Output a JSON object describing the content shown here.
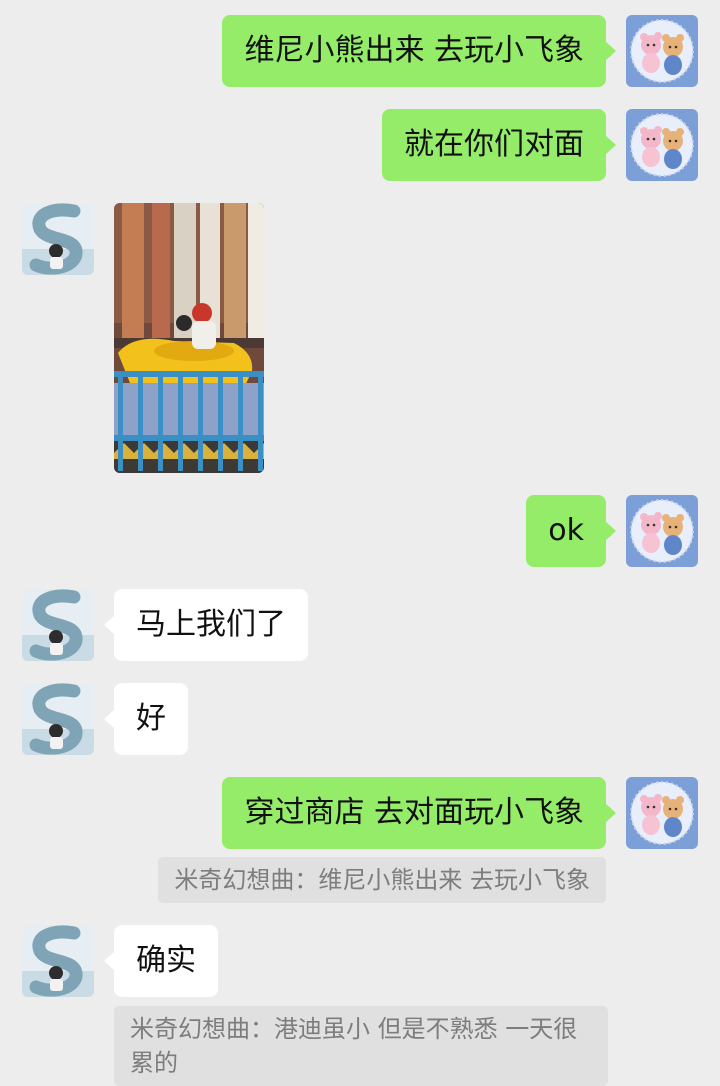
{
  "messages": [
    {
      "text": "维尼小熊出来 去玩小飞象"
    },
    {
      "text": "就在你们对面"
    },
    {
      "image": "photo-amusement-ride"
    },
    {
      "text": "ok"
    },
    {
      "text": "马上我们了"
    },
    {
      "text": "好"
    },
    {
      "text": "穿过商店 去对面玩小飞象",
      "quote": "米奇幻想曲：维尼小熊出来 去玩小飞象"
    },
    {
      "text": "确实",
      "quote": "米奇幻想曲：港迪虽小 但是不熟悉 一天很累的"
    }
  ],
  "colors": {
    "background": "#ededed",
    "outgoing_bubble": "#95ec69",
    "incoming_bubble": "#ffffff",
    "quote_background": "#e0e0e0",
    "quote_text": "#7d7d7d"
  },
  "icons": {
    "self_avatar": "cartoon-bears-avatar-icon",
    "contact_avatar": "seaside-s-letter-avatar-icon"
  }
}
